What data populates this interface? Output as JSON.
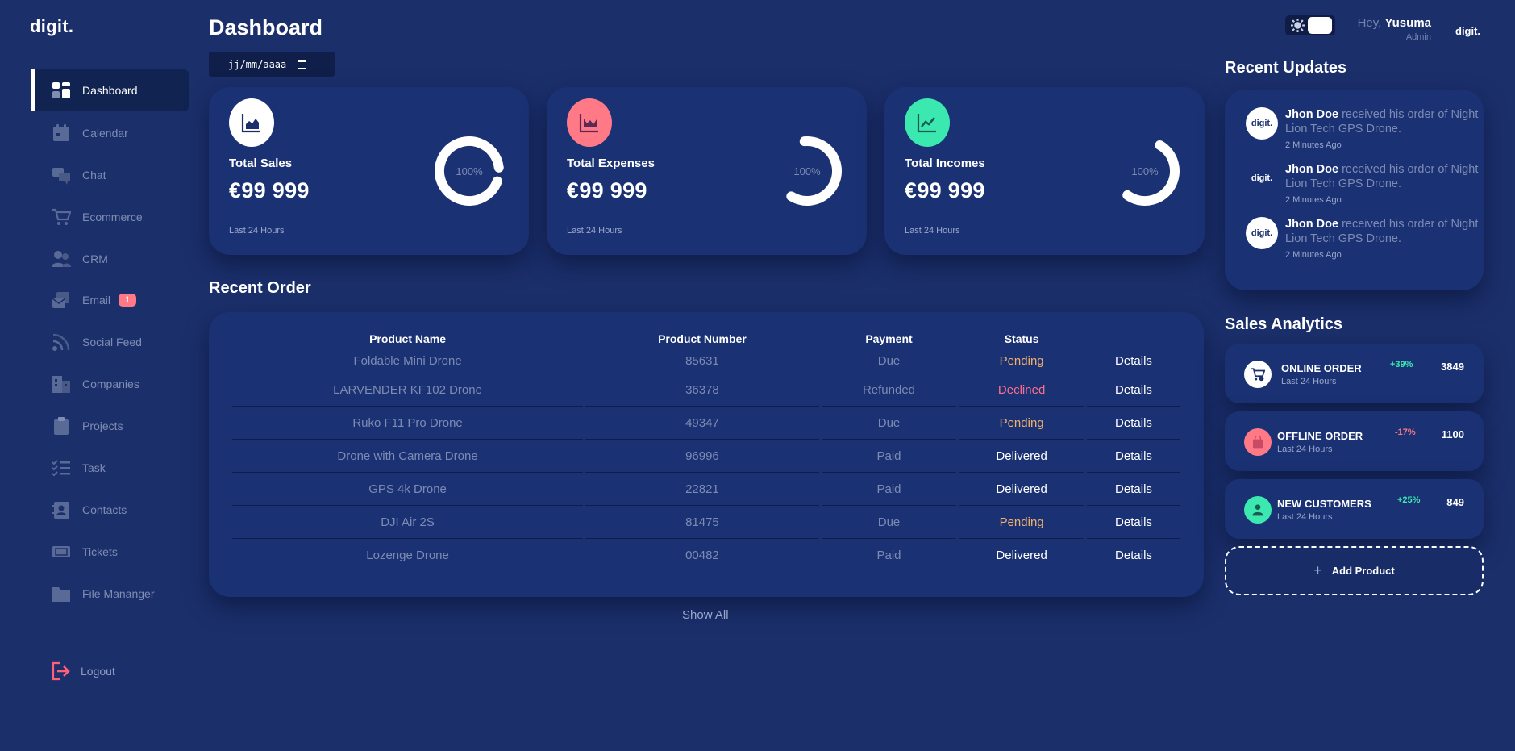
{
  "brand": {
    "logo": "digit."
  },
  "sidebar": {
    "items": [
      {
        "label": "Dashboard",
        "icon": "dashboard-icon",
        "active": true
      },
      {
        "label": "Calendar",
        "icon": "calendar-icon"
      },
      {
        "label": "Chat",
        "icon": "chat-icon"
      },
      {
        "label": "Ecommerce",
        "icon": "cart-icon"
      },
      {
        "label": "CRM",
        "icon": "users-icon"
      },
      {
        "label": "Email",
        "icon": "email-icon",
        "badge": "1"
      },
      {
        "label": "Social Feed",
        "icon": "rss-icon"
      },
      {
        "label": "Companies",
        "icon": "building-icon"
      },
      {
        "label": "Projects",
        "icon": "clipboard-icon"
      },
      {
        "label": "Task",
        "icon": "checklist-icon"
      },
      {
        "label": "Contacts",
        "icon": "contact-card-icon"
      },
      {
        "label": "Tickets",
        "icon": "ticket-icon"
      },
      {
        "label": "File Mananger",
        "icon": "folder-icon"
      }
    ],
    "logout": "Logout"
  },
  "header": {
    "title": "Dashboard",
    "date_placeholder": "jj/mm/aaaa",
    "greeting": "Hey,",
    "user": "Yusuma",
    "role": "Admin",
    "top_logo": "digit."
  },
  "stats": [
    {
      "label": "Total Sales",
      "value": "€99 999",
      "sub": "Last 24 Hours",
      "ring": "100%",
      "color": "#ffffff",
      "icon": "area-chart-icon"
    },
    {
      "label": "Total Expenses",
      "value": "€99 999",
      "sub": "Last 24 Hours",
      "ring": "100%",
      "color": "#ff7a86",
      "icon": "down-chart-icon"
    },
    {
      "label": "Total Incomes",
      "value": "€99 999",
      "sub": "Last 24 Hours",
      "ring": "100%",
      "color": "#3be8b0",
      "icon": "line-chart-icon"
    }
  ],
  "orders": {
    "title": "Recent Order",
    "columns": [
      "Product Name",
      "Product Number",
      "Payment",
      "Status",
      ""
    ],
    "rows": [
      {
        "name": "Foldable Mini Drone",
        "number": "85631",
        "payment": "Due",
        "status": "Pending",
        "action": "Details"
      },
      {
        "name": "LARVENDER KF102 Drone",
        "number": "36378",
        "payment": "Refunded",
        "status": "Declined",
        "action": "Details"
      },
      {
        "name": "Ruko F11 Pro Drone",
        "number": "49347",
        "payment": "Due",
        "status": "Pending",
        "action": "Details"
      },
      {
        "name": "Drone with Camera Drone",
        "number": "96996",
        "payment": "Paid",
        "status": "Delivered",
        "action": "Details"
      },
      {
        "name": "GPS 4k Drone",
        "number": "22821",
        "payment": "Paid",
        "status": "Delivered",
        "action": "Details"
      },
      {
        "name": "DJI Air 2S",
        "number": "81475",
        "payment": "Due",
        "status": "Pending",
        "action": "Details"
      },
      {
        "name": "Lozenge Drone",
        "number": "00482",
        "payment": "Paid",
        "status": "Delivered",
        "action": "Details"
      }
    ],
    "show_all": "Show All"
  },
  "updates": {
    "title": "Recent Updates",
    "items": [
      {
        "avatar": "digit.",
        "name": "Jhon Doe",
        "text": "received his order of Night Lion Tech GPS Drone.",
        "time": "2 Minutes Ago"
      },
      {
        "avatar": "digit.",
        "name": "Jhon Doe",
        "text": "received his order of Night Lion Tech GPS Drone.",
        "time": "2 Minutes Ago"
      },
      {
        "avatar": "digit.",
        "name": "Jhon Doe",
        "text": "received his order of Night Lion Tech GPS Drone.",
        "time": "2 Minutes Ago"
      }
    ]
  },
  "analytics": {
    "title": "Sales Analytics",
    "items": [
      {
        "name": "ONLINE ORDER",
        "sub": "Last 24 Hours",
        "pct": "+39%",
        "num": "3849",
        "pct_color": "#3be8b0",
        "icon_bg": "#ffffff",
        "icon": "cart-icon"
      },
      {
        "name": "OFFLINE ORDER",
        "sub": "Last 24 Hours",
        "pct": "-17%",
        "num": "1100",
        "pct_color": "#ff7a86",
        "icon_bg": "#ff7a86",
        "icon": "bag-icon"
      },
      {
        "name": "NEW CUSTOMERS",
        "sub": "Last 24 Hours",
        "pct": "+25%",
        "num": "849",
        "pct_color": "#3be8b0",
        "icon_bg": "#3be8b0",
        "icon": "user-icon"
      }
    ],
    "add_label": "Add Product"
  }
}
